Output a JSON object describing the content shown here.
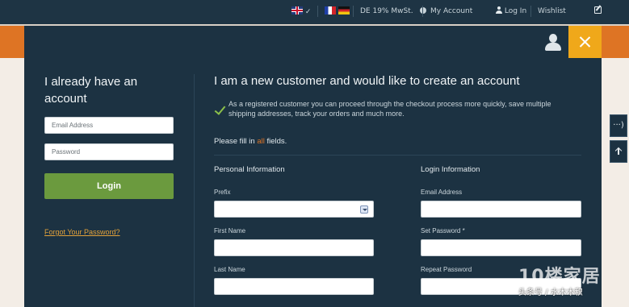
{
  "topbar": {
    "lang_check": "✓",
    "vat": "DE 19% MwSt.",
    "my_account": "My Account",
    "login": "Log In",
    "wishlist": "Wishlist"
  },
  "left": {
    "title": "I already have an account",
    "email_placeholder": "Email Address",
    "password_placeholder": "Password",
    "login_button": "Login",
    "forgot_link": "Forgot Your Password?"
  },
  "right": {
    "title": "I am a new customer and would like to create an account",
    "info": "As a registered customer you can proceed through the checkout process more quickly, save multiple shipping addresses, track your orders and much more.",
    "fill_prefix": "Please fill in ",
    "fill_highlight": "all",
    "fill_suffix": " fields.",
    "personal_title": "Personal Information",
    "login_title": "Login Information",
    "prefix_label": "Prefix",
    "first_name_label": "First Name",
    "last_name_label": "Last Name",
    "email_label": "Email Address",
    "set_password_label": "Set Password *",
    "repeat_password_label": "Repeat Password"
  },
  "side": {
    "share_label": "···)"
  },
  "watermark": {
    "logo": "10楼家居",
    "sub": "头条号 / 水木木积"
  },
  "colors": {
    "topbar_bg": "#1e3444",
    "modal_bg": "#1c3242",
    "accent_orange": "#de7424",
    "close_yellow": "#f0a81a",
    "login_green": "#6b9a3e",
    "link_gold": "#e3a23a"
  },
  "icons": [
    "flag-uk-icon",
    "flag-fr-icon",
    "flag-de-icon",
    "circle-icon",
    "user-icon",
    "edit-icon",
    "close-icon",
    "avatar-icon",
    "check-icon",
    "chevron-down-icon",
    "share-icon",
    "arrow-up-icon"
  ]
}
